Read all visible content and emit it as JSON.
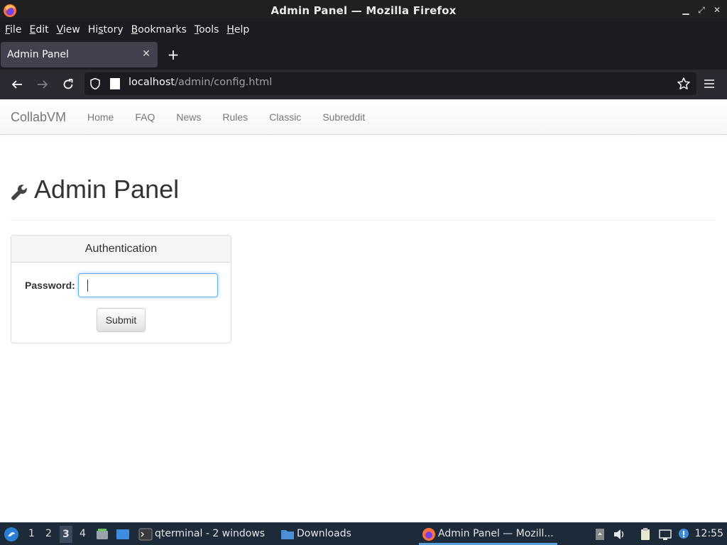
{
  "window": {
    "title": "Admin Panel — Mozilla Firefox"
  },
  "menubar": {
    "items": [
      {
        "u": "F",
        "rest": "ile"
      },
      {
        "u": "E",
        "rest": "dit"
      },
      {
        "u": "V",
        "rest": "iew"
      },
      {
        "pre": "Hi",
        "u": "s",
        "rest": "tory"
      },
      {
        "u": "B",
        "rest": "ookmarks"
      },
      {
        "u": "T",
        "rest": "ools"
      },
      {
        "u": "H",
        "rest": "elp"
      }
    ]
  },
  "tabs": [
    {
      "label": "Admin Panel"
    }
  ],
  "urlbar": {
    "host": "localhost",
    "path": "/admin/config.html"
  },
  "site": {
    "brand": "CollabVM",
    "nav": [
      "Home",
      "FAQ",
      "News",
      "Rules",
      "Classic",
      "Subreddit"
    ]
  },
  "main": {
    "title": "Admin Panel",
    "auth_panel": {
      "heading": "Authentication",
      "password_label": "Password:",
      "password_value": "",
      "submit_label": "Submit"
    }
  },
  "taskbar": {
    "workspaces": [
      "1",
      "2",
      "3",
      "4"
    ],
    "active_workspace": "3",
    "tasks": [
      {
        "label": "qterminal - 2 windows"
      },
      {
        "label": "Downloads"
      },
      {
        "label": "Admin Panel — Mozill..."
      }
    ],
    "clock": "12:55"
  },
  "colors": {
    "focus_ring": "#66afe9",
    "taskbar_bg": "#1d2a3a",
    "browser_chrome": "#1c1b22"
  }
}
